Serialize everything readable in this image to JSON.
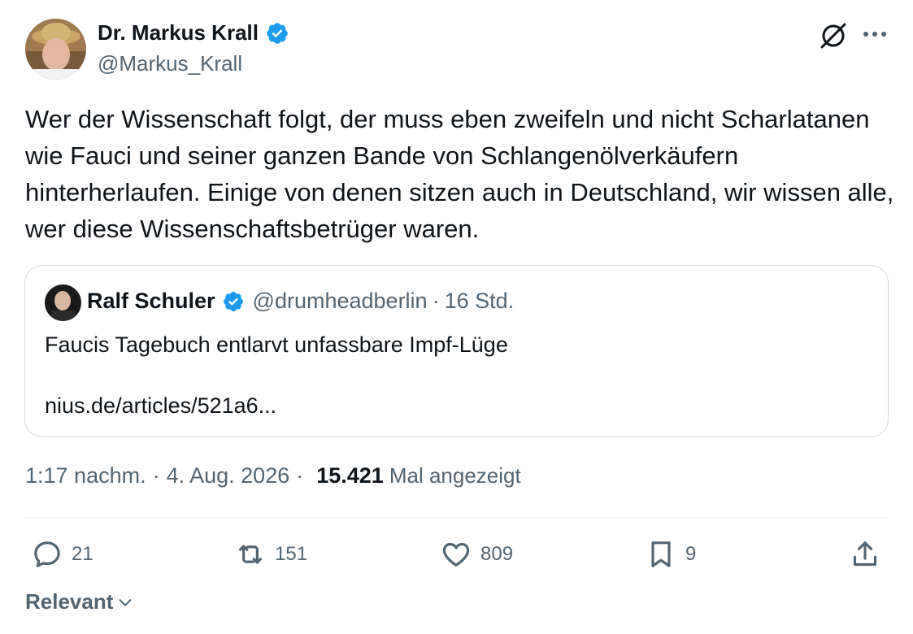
{
  "author": {
    "name": "Dr. Markus Krall",
    "handle": "@Markus_Krall"
  },
  "tweet": {
    "text": "Wer der Wissenschaft folgt, der muss eben zweifeln und nicht Scharlatanen wie Fauci und seiner ganzen Bande von Schlangenölverkäufern hinterherlaufen. Einige von denen sitzen auch in Deutschland, wir wissen alle, wer diese Wissenschaftsbetrüger waren."
  },
  "quote": {
    "name": "Ralf Schuler",
    "handle": "@drumheadberlin",
    "separator": "·",
    "time": "16 Std.",
    "text": "Faucis Tagebuch entlarvt unfassbare Impf-Lüge",
    "link": "nius.de/articles/521a6..."
  },
  "meta": {
    "time": "1:17 nachm.",
    "separator": "·",
    "date": "4. Aug. 2026",
    "views": "15.421",
    "views_label": "Mal angezeigt"
  },
  "actions": {
    "replies": "21",
    "reposts": "151",
    "likes": "809",
    "bookmarks": "9"
  },
  "sort": {
    "label": "Relevant"
  },
  "colors": {
    "verified": "#1d9bf0",
    "text_primary": "#0f1419",
    "text_secondary": "#536471",
    "border": "#cfd9de"
  }
}
